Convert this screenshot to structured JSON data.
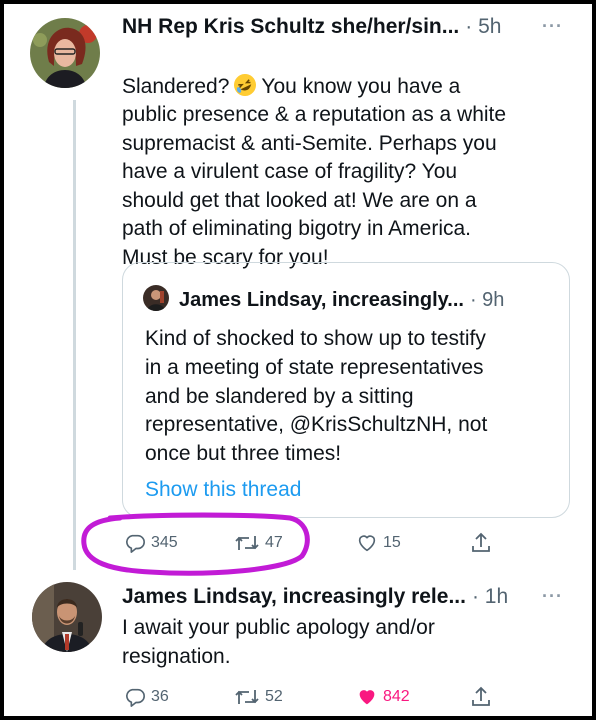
{
  "tweets": [
    {
      "author": "NH Rep Kris Schultz she/her/sin...",
      "time": "· 5h",
      "more_icon": "more-horizontal-icon",
      "text_before_emoji": "Slandered?",
      "emoji": "rolling-on-floor-laughing-emoji",
      "text_after_emoji": "You know you have a\npublic presence & a reputation as a white\nsupremacist & anti-Semite. Perhaps you\nhave a virulent case of fragility? You\nshould get that looked at! We are on a\npath of eliminating bigotry in America.\nMust be scary for you!",
      "quote": {
        "author": "James Lindsay, increasingly...",
        "time": "· 9h",
        "text": "Kind of shocked to show up to testify\nin a meeting of state representatives\nand be slandered by a sitting\nrepresentative, @KrisSchultzNH, not\nonce but three times!",
        "show_thread": "Show this thread"
      },
      "actions": {
        "replies": "345",
        "retweets": "47",
        "likes": "15"
      }
    },
    {
      "author": "James Lindsay, increasingly rele...",
      "time": "· 1h",
      "more_icon": "more-horizontal-icon",
      "text": "I await your public apology and/or\nresignation.",
      "actions": {
        "replies": "36",
        "retweets": "52",
        "likes": "842",
        "liked": true
      }
    }
  ],
  "colors": {
    "text_primary": "#0f1419",
    "text_secondary": "#536471",
    "link": "#1d9bf0",
    "like_active": "#f91880",
    "annotation": "#c21bd6"
  }
}
